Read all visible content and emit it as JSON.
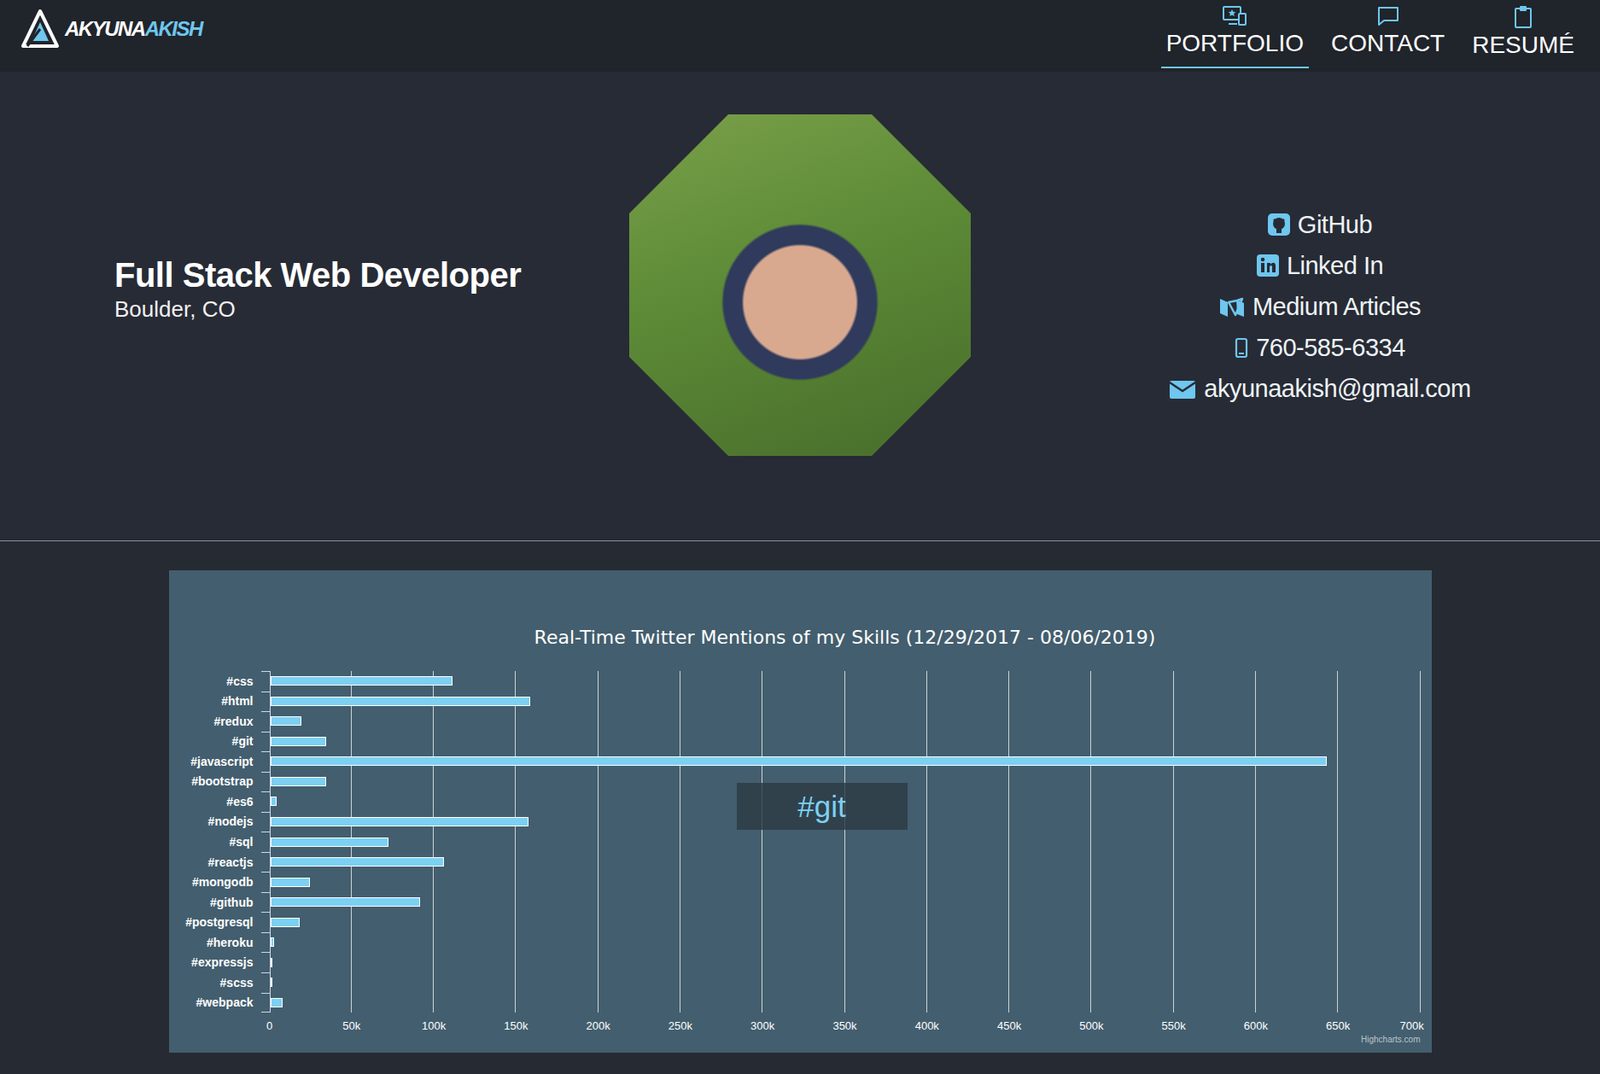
{
  "logo": {
    "text_white": "AKYUNA",
    "text_blue": "AKISH"
  },
  "nav": [
    {
      "label": "PORTFOLIO",
      "selected": true,
      "kind": "portfolio"
    },
    {
      "label": "CONTACT",
      "selected": false,
      "kind": "contact"
    },
    {
      "label": "RESUMÉ",
      "selected": false,
      "kind": "resume"
    }
  ],
  "hero": {
    "title": "Full Stack Web Developer",
    "location": "Boulder, CO"
  },
  "links": [
    {
      "label": "GitHub",
      "kind": "github"
    },
    {
      "label": "Linked In",
      "kind": "linkedin"
    },
    {
      "label": "Medium Articles",
      "kind": "medium"
    },
    {
      "label": "760-585-6334",
      "kind": "phone"
    },
    {
      "label": "akyunaakish@gmail.com",
      "kind": "email"
    }
  ],
  "chart": {
    "title": "Real-Time Twitter Mentions of my Skills (12/29/2017 - 08/06/2019)",
    "categories": [
      "#css",
      "#html",
      "#redux",
      "#git",
      "#javascript",
      "#bootstrap",
      "#es6",
      "#nodejs",
      "#sql",
      "#reactjs",
      "#mongodb",
      "#github",
      "#postgresql",
      "#heroku",
      "#expressjs",
      "#scss",
      "#webpack"
    ],
    "series": [
      {
        "values": [
          111000,
          158000,
          19000,
          34000,
          643000,
          34000,
          4000,
          157000,
          72000,
          105500,
          24000,
          91000,
          18000,
          2500,
          1200,
          600,
          7400
        ]
      }
    ],
    "x_max": 700000,
    "x_ticks": [
      "0",
      "50k",
      "100k",
      "150k",
      "200k",
      "250k",
      "300k",
      "350k",
      "400k",
      "450k",
      "500k",
      "550k",
      "600k",
      "650k",
      "700k"
    ],
    "tooltip": "#git",
    "credit": "Highcharts.com"
  }
}
